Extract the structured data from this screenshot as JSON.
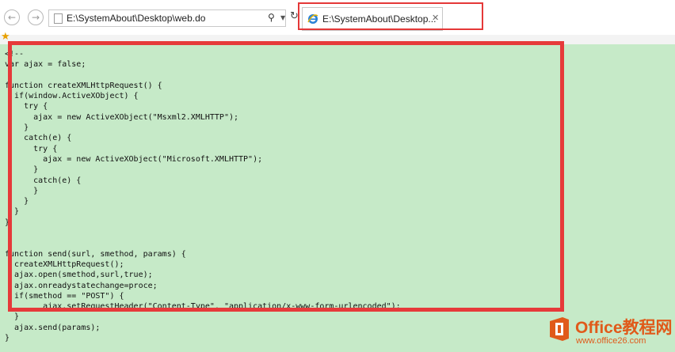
{
  "browser": {
    "address": "E:\\SystemAbout\\Desktop\\web.do",
    "tab_title": "E:\\SystemAbout\\Desktop...",
    "back_icon": "back-arrow-icon",
    "forward_icon": "forward-arrow-icon",
    "search_icon": "search-icon",
    "refresh_icon": "refresh-icon",
    "close_icon": "close-icon"
  },
  "code_lines": [
    "<!--",
    "var ajax = false;",
    "",
    "function createXMLHttpRequest() {",
    "  if(window.ActiveXObject) {",
    "    try {",
    "      ajax = new ActiveXObject(\"Msxml2.XMLHTTP\");",
    "    }",
    "    catch(e) {",
    "      try {",
    "        ajax = new ActiveXObject(\"Microsoft.XMLHTTP\");",
    "      }",
    "      catch(e) {",
    "      }",
    "    }",
    "  }",
    "}",
    "",
    "",
    "function send(surl, smethod, params) {",
    "  createXMLHttpRequest();",
    "  ajax.open(smethod,surl,true);",
    "  ajax.onreadystatechange=proce;",
    "  if(smethod == \"POST\") {",
    "        ajax.setRequestHeader(\"Content-Type\", \"application/x-www-form-urlencoded\");",
    "  }",
    "  ajax.send(params);",
    "}"
  ],
  "watermark": {
    "name": "Office教程网",
    "site": "www.office26.com"
  },
  "colors": {
    "highlight": "#e53838",
    "page_background": "#c6eac8",
    "watermark": "#e05a1a"
  }
}
